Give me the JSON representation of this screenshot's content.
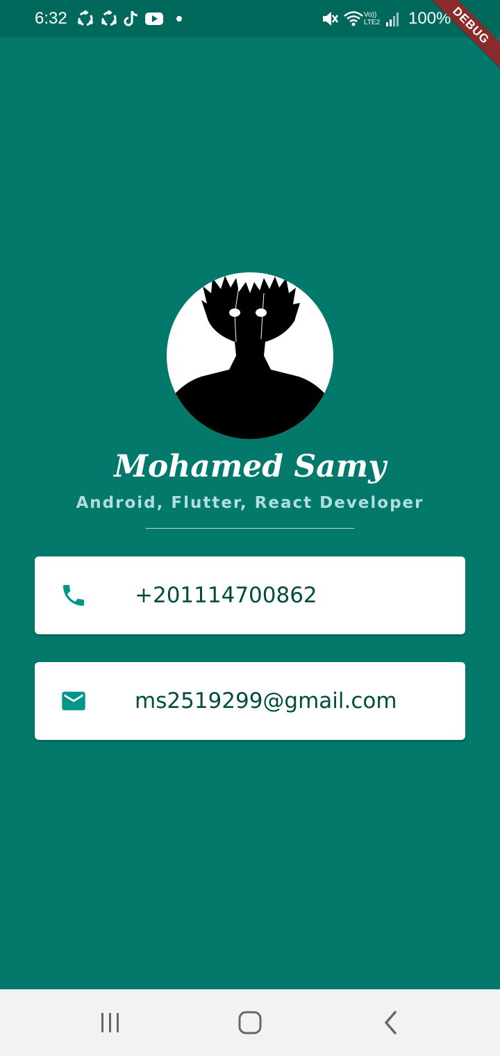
{
  "status_bar": {
    "time": "6:32",
    "battery": "100%",
    "network": "Vo)) LTE2",
    "notification_icons": [
      "sync-icon",
      "sync-icon",
      "tiktok-icon",
      "youtube-icon",
      "dot-icon"
    ],
    "status_icons": [
      "mute-icon",
      "wifi-icon",
      "signal-icon",
      "battery-icon"
    ]
  },
  "debug_banner": "DEBUG",
  "profile": {
    "name": "Mohamed Samy",
    "title": "Android, Flutter, React Developer"
  },
  "contacts": {
    "phone": {
      "icon": "phone-icon",
      "value": "+201114700862"
    },
    "email": {
      "icon": "email-icon",
      "value": "ms2519299@gmail.com"
    }
  },
  "nav_bar": {
    "buttons": [
      "recent-apps-icon",
      "home-icon",
      "back-icon"
    ]
  },
  "colors": {
    "background": "#02796B",
    "status_bar": "#00695C",
    "icon_accent": "#009688",
    "card_text": "#004D40",
    "subtitle": "#B2DFDB"
  }
}
